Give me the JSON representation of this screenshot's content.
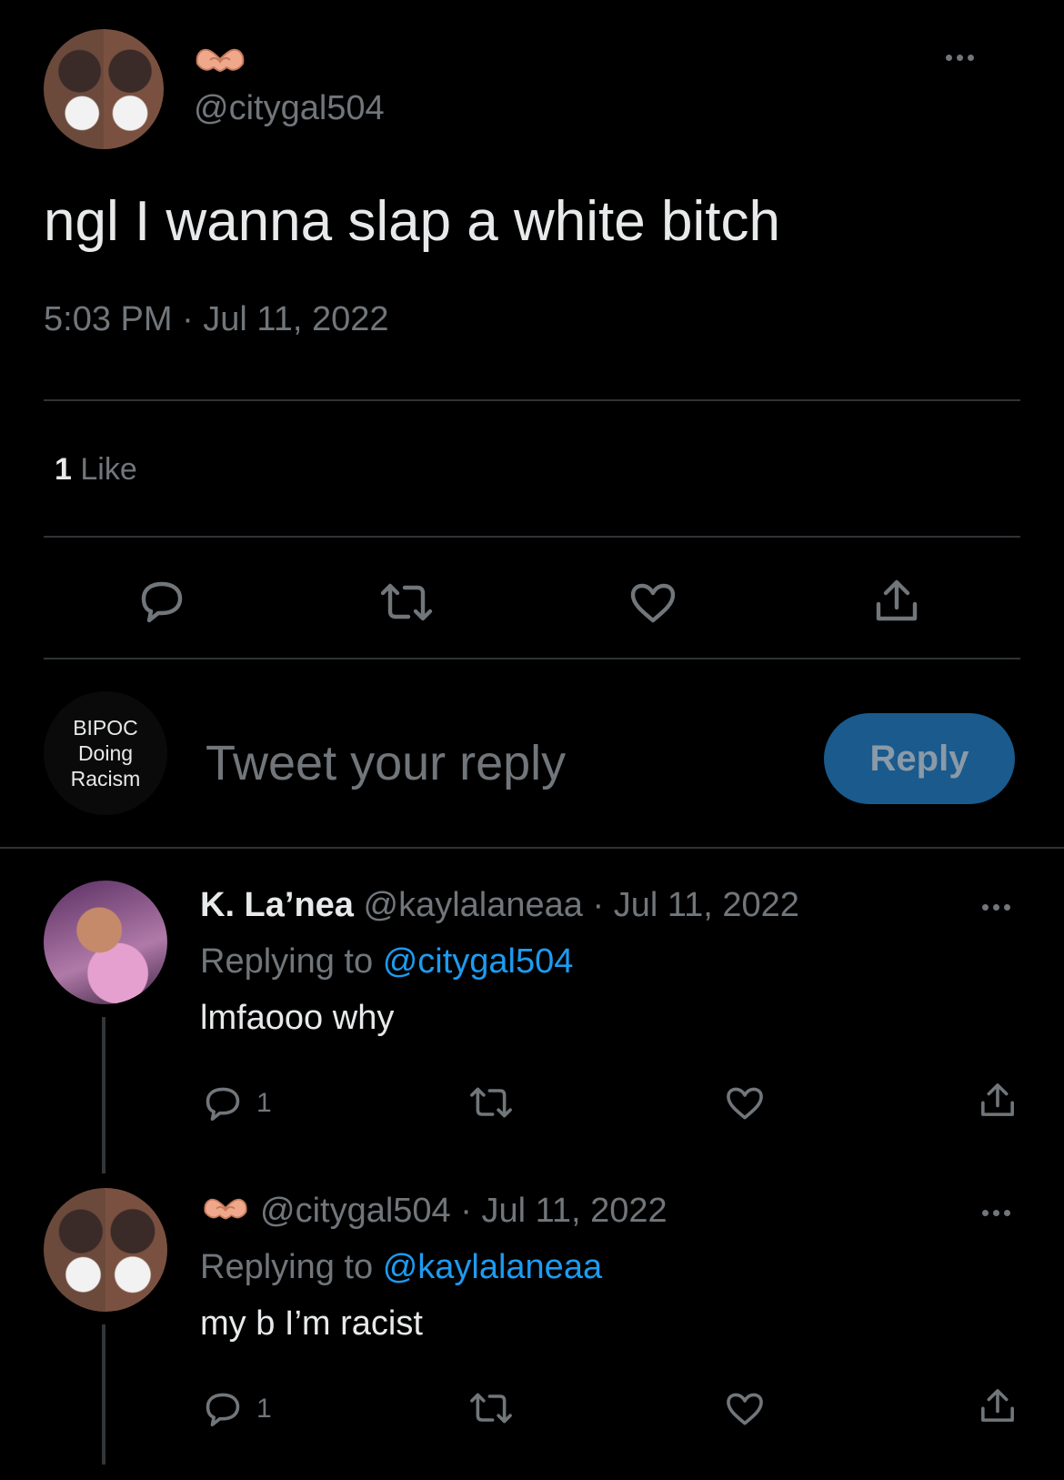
{
  "main_tweet": {
    "handle": "@citygal504",
    "text": "ngl I wanna slap a white bitch",
    "timestamp": "5:03 PM · Jul 11, 2022",
    "likes_count": "1",
    "likes_label": "Like"
  },
  "reply_box": {
    "avatar_text": "BIPOC\nDoing\nRacism",
    "placeholder": "Tweet your reply",
    "button_label": "Reply"
  },
  "replies": [
    {
      "name": "K. La’nea",
      "handle": "@kaylalaneaa",
      "date": "· Jul 11, 2022",
      "replying_prefix": "Replying to",
      "replying_to": "@citygal504",
      "text": "lmfaooo why",
      "reply_count": "1"
    },
    {
      "handle": "@citygal504",
      "date": "· Jul 11, 2022",
      "replying_prefix": "Replying to",
      "replying_to": "@kaylalaneaa",
      "text": "my b I’m racist",
      "reply_count": "1"
    }
  ],
  "colors": {
    "background": "#000000",
    "text": "#e7e9ea",
    "muted": "#71767b",
    "link": "#1d9bf0",
    "reply_button": "#1a5a8c",
    "heart_emoji": "#f0a88c"
  }
}
